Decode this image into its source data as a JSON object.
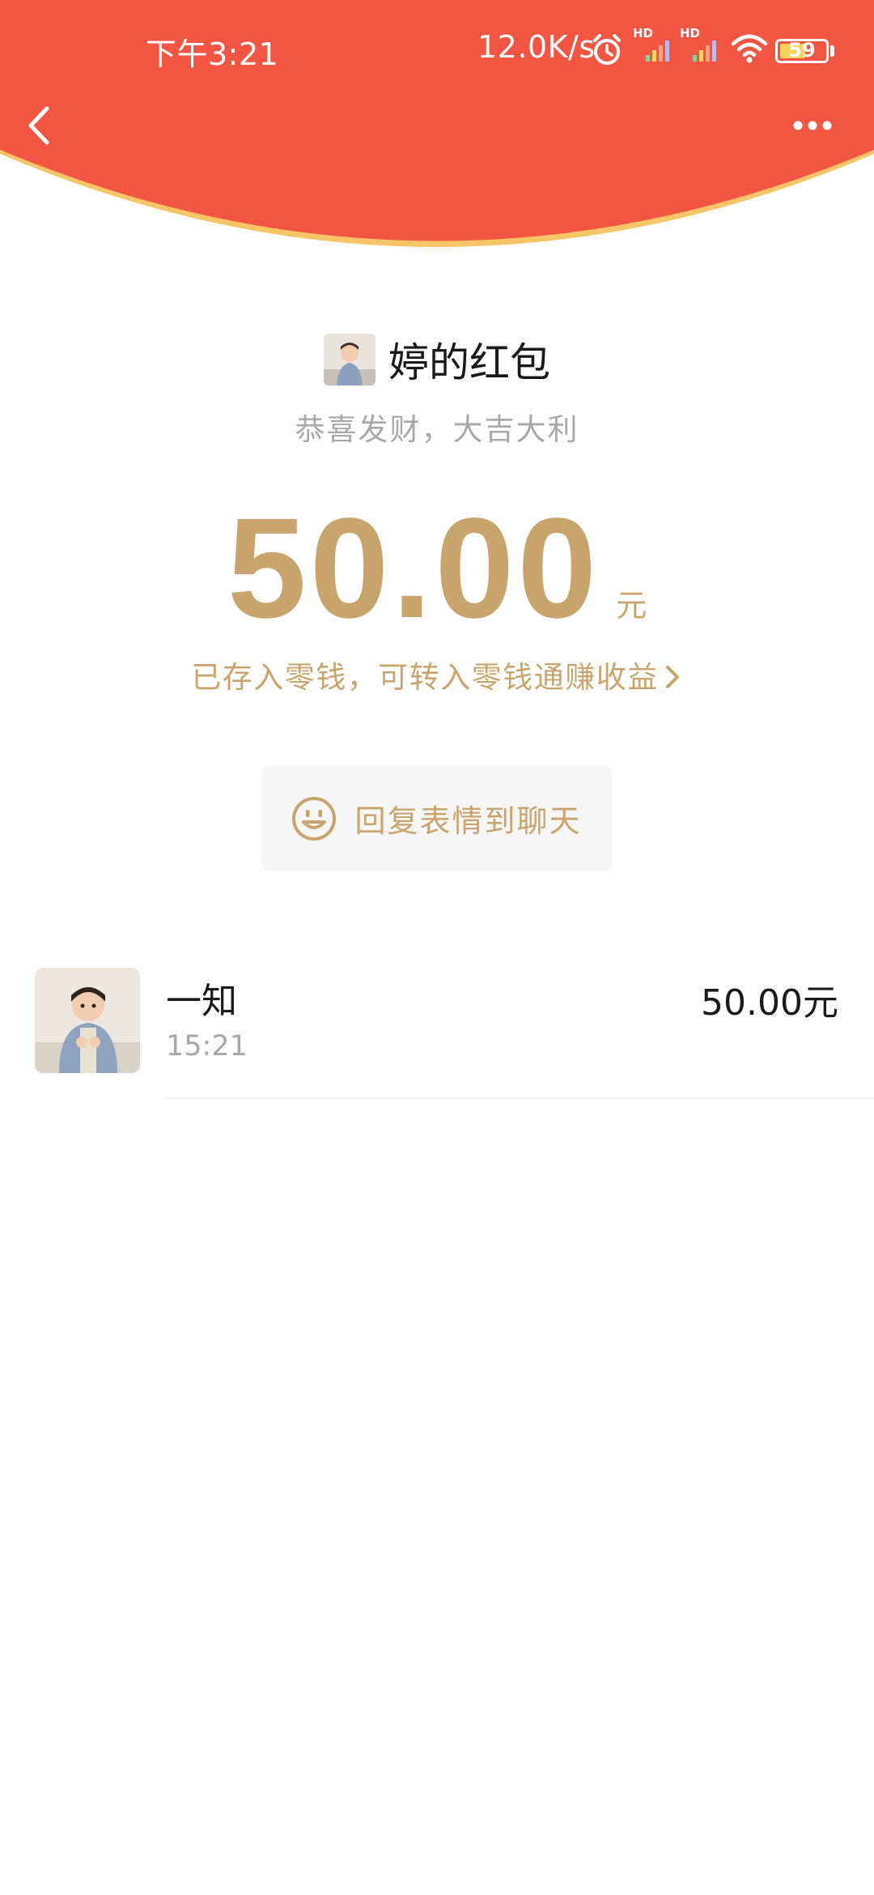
{
  "status_bar": {
    "time": "下午3:21",
    "network_speed": "12.0K/s",
    "signal_badge_1": "HD",
    "signal_badge_2": "HD",
    "battery": "59",
    "icons": [
      "alarm-icon",
      "signal-icon",
      "signal-icon",
      "wifi-icon",
      "battery-icon"
    ]
  },
  "nav": {
    "back_icon": "chevron-left-icon",
    "more_icon": "more-dots-icon"
  },
  "packet": {
    "title": "婷的红包",
    "greeting": "恭喜发财，大吉大利",
    "amount": "50.00",
    "unit": "元",
    "change_notice": "已存入零钱，可转入零钱通赚收益"
  },
  "reply": {
    "label": "回复表情到聊天",
    "icon": "smiley-icon"
  },
  "records": [
    {
      "name": "一知",
      "time": "15:21",
      "amount": "50.00元"
    }
  ],
  "colors": {
    "header_red": "#f25542",
    "header_edge": "#f7c566",
    "gold": "#c9a46c",
    "gray_text": "#a8a8a8",
    "button_bg": "#f6f6f6"
  }
}
